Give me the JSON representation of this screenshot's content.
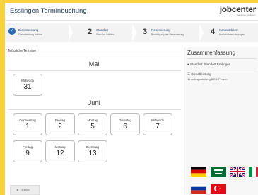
{
  "app_title": "Esslingen Terminbuchung",
  "logo": {
    "main": "jobcenter",
    "sub": "Landkreis Esslingen"
  },
  "steps": [
    {
      "num": "",
      "title": "Dienstleistung",
      "subtitle": "Dienstleistung wählen",
      "done": true
    },
    {
      "num": "2",
      "title": "Standort",
      "subtitle": "Standort wählen"
    },
    {
      "num": "3",
      "title": "Reservierung",
      "subtitle": "Bestätigung der Reservierung"
    },
    {
      "num": "4",
      "title": "Kontaktdaten",
      "subtitle": "Kontaktdaten eintragen"
    }
  ],
  "section_label": "Mögliche Termine",
  "months": [
    {
      "name": "Mai",
      "days": [
        {
          "weekday": "Mittwoch",
          "day": "31"
        }
      ]
    },
    {
      "name": "Juni",
      "days": [
        {
          "weekday": "Donnerstag",
          "day": "1"
        },
        {
          "weekday": "Freitag",
          "day": "2"
        },
        {
          "weekday": "Montag",
          "day": "5"
        },
        {
          "weekday": "Dienstag",
          "day": "6"
        },
        {
          "weekday": "Mittwoch",
          "day": "7"
        },
        {
          "weekday": "Freitag",
          "day": "9"
        },
        {
          "weekday": "Montag",
          "day": "12"
        },
        {
          "weekday": "Dienstag",
          "day": "13"
        }
      ]
    }
  ],
  "back_label": "zurück",
  "summary": {
    "title": "Zusammenfassung",
    "location": "Standort: Standort Esslingen",
    "service_label": "Dienstleistung",
    "service_detail": "1x Antragsstellung BG 1 Person"
  },
  "languages": [
    "german-flag",
    "arabic-flag",
    "uk-flag",
    "italian-flag",
    "russian-flag",
    "turkish-flag"
  ],
  "colors": {
    "accent": "#2d6bb5",
    "title": "#25406b",
    "background": "#f6d23c"
  }
}
